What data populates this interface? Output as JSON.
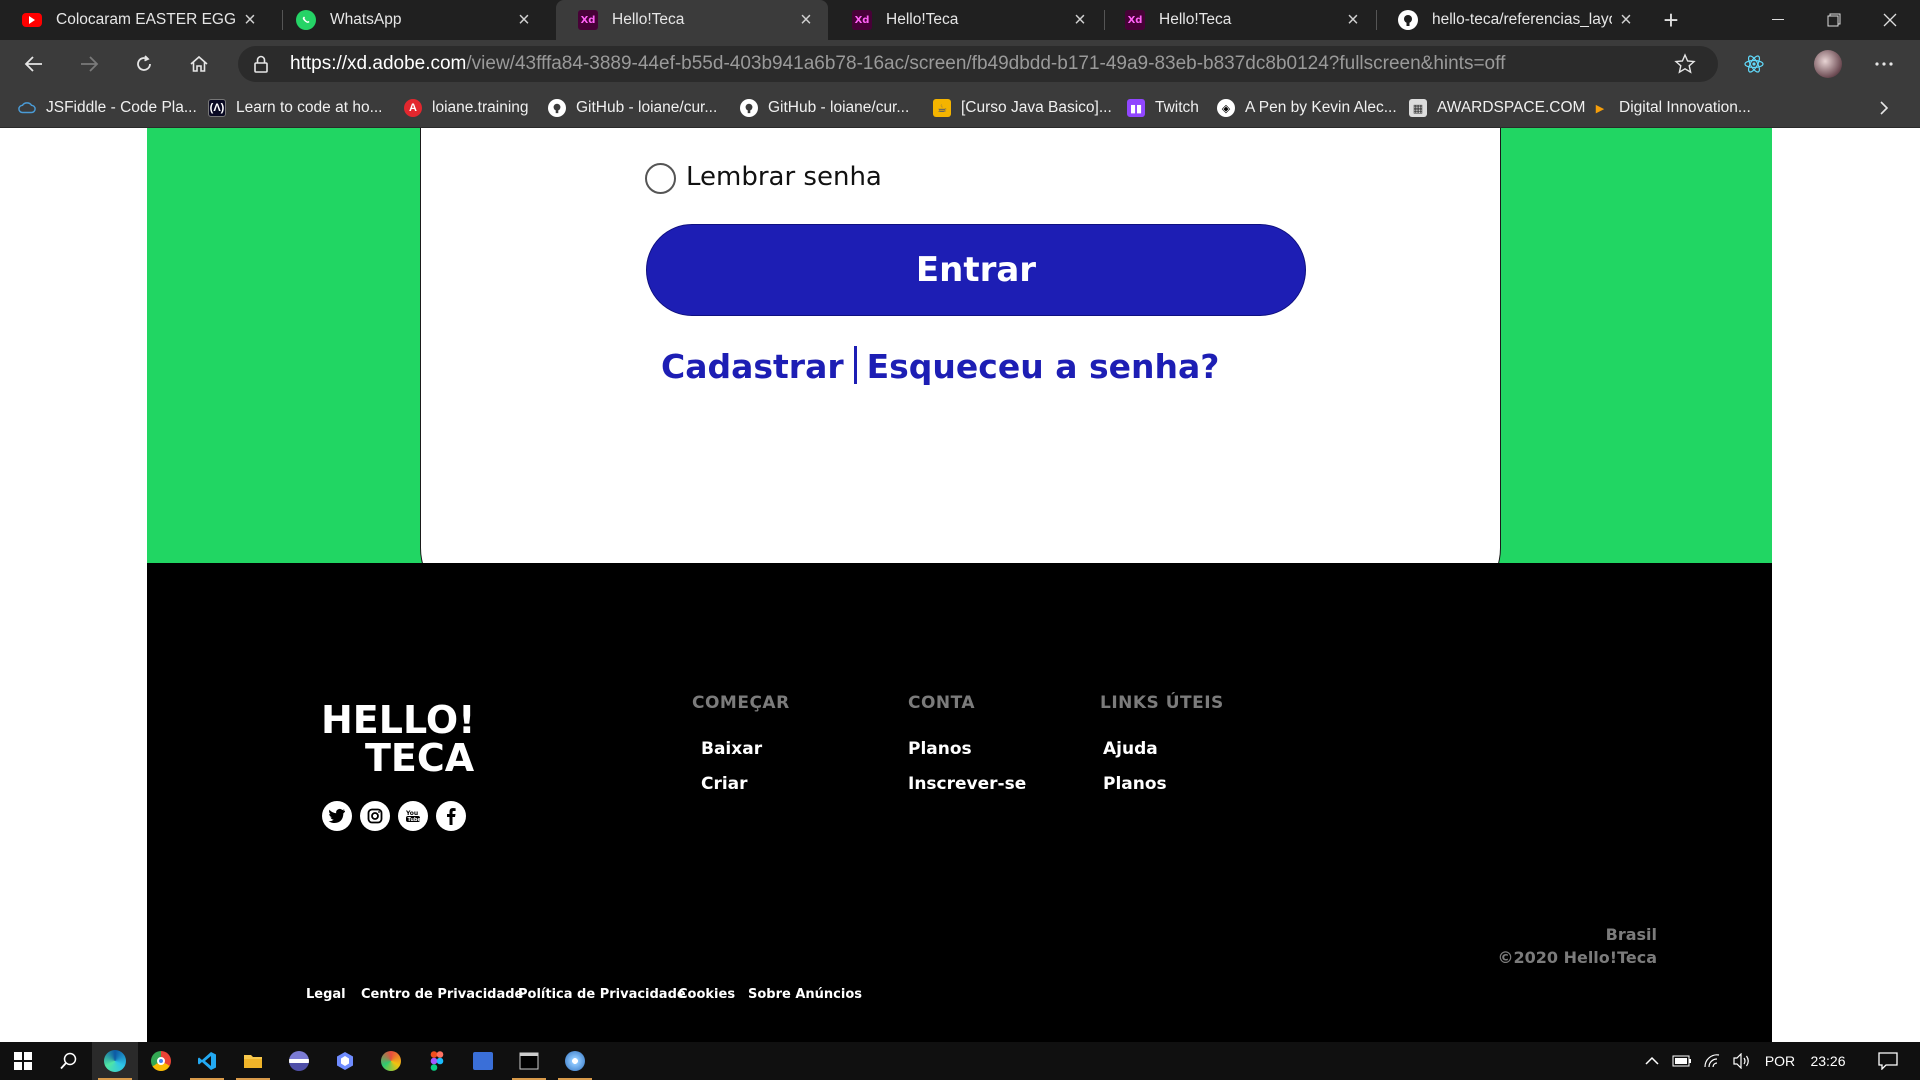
{
  "browser": {
    "tabs": [
      {
        "title": "Colocaram EASTER EGG na D",
        "icon": "youtube-icon",
        "active": false
      },
      {
        "title": "WhatsApp",
        "icon": "whatsapp-icon",
        "active": false
      },
      {
        "title": "Hello!Teca",
        "icon": "adobe-xd-icon",
        "active": true
      },
      {
        "title": "Hello!Teca",
        "icon": "adobe-xd-icon",
        "active": false
      },
      {
        "title": "Hello!Teca",
        "icon": "adobe-xd-icon",
        "active": false
      },
      {
        "title": "hello-teca/referencias_layout",
        "icon": "github-icon",
        "active": false
      }
    ],
    "url_scheme": "https://",
    "url_host": "xd.adobe.com",
    "url_path": "/view/43fffa84-3889-44ef-b55d-403b941a6b78-16ac/screen/fb49dbdd-b171-49a9-83eb-b837dc8b0124?fullscreen&hints=off",
    "xd_icon_text": "Xd",
    "bookmarks": [
      {
        "label": "JSFiddle - Code Pla...",
        "icon": "jsfiddle-icon"
      },
      {
        "label": "Learn to code at ho...",
        "icon": "freecodecamp-icon"
      },
      {
        "label": "loiane.training",
        "icon": "loiane-icon"
      },
      {
        "label": "GitHub - loiane/cur...",
        "icon": "github-icon"
      },
      {
        "label": "GitHub - loiane/cur...",
        "icon": "github-icon"
      },
      {
        "label": "[Curso Java Basico]...",
        "icon": "java-icon"
      },
      {
        "label": "Twitch",
        "icon": "twitch-icon"
      },
      {
        "label": "A Pen by Kevin Alec...",
        "icon": "codepen-icon"
      },
      {
        "label": "AWARDSPACE.COM",
        "icon": "awardspace-icon"
      },
      {
        "label": "Digital Innovation...",
        "icon": "dio-icon"
      }
    ]
  },
  "login": {
    "remember_label": "Lembrar senha",
    "enter_label": "Entrar",
    "register_label": "Cadastrar",
    "forgot_label": "Esqueceu a senha?"
  },
  "footer": {
    "logo_line1": "HELLO!",
    "logo_line2": "TECA",
    "columns": [
      {
        "heading": "COMEÇAR",
        "items": [
          "Baixar",
          "Criar"
        ]
      },
      {
        "heading": "CONTA",
        "items": [
          "Planos",
          "Inscrever-se"
        ]
      },
      {
        "heading": "LINKS ÚTEIS",
        "items": [
          "Ajuda",
          "Planos"
        ]
      }
    ],
    "legal_links": [
      "Legal",
      "Centro de Privacidade",
      "Política de Privacidade",
      "Cookies",
      "Sobre Anúncios"
    ],
    "country": "Brasil",
    "copyright": "©2020 Hello!Teca",
    "social": [
      "twitter-icon",
      "instagram-icon",
      "youtube-icon",
      "facebook-icon"
    ]
  },
  "taskbar": {
    "language": "POR",
    "time": "23:26"
  },
  "colors": {
    "green": "#21d663",
    "button_blue": "#1d1eb4",
    "footer_bg": "#000000"
  }
}
